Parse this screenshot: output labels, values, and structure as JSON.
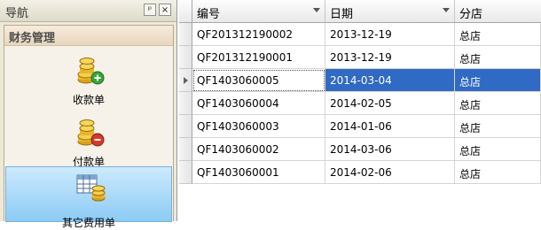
{
  "nav": {
    "title": "导航",
    "pin_glyph": "ᵖ",
    "close_glyph": "×",
    "group_title": "财务管理",
    "items": [
      {
        "label": "收款单",
        "icon": "coins-add-icon"
      },
      {
        "label": "付款单",
        "icon": "coins-remove-icon"
      },
      {
        "label": "其它费用单",
        "icon": "table-coins-icon"
      }
    ]
  },
  "grid": {
    "columns": [
      "编号",
      "日期",
      "分店"
    ],
    "rows": [
      {
        "code": "QF201312190002",
        "date": "2013-12-19",
        "store": "总店"
      },
      {
        "code": "QF201312190001",
        "date": "2013-12-19",
        "store": "总店"
      },
      {
        "code": "QF1403060005",
        "date": "2014-03-04",
        "store": "总店",
        "selected": true
      },
      {
        "code": "QF1403060004",
        "date": "2014-02-05",
        "store": "总店"
      },
      {
        "code": "QF1403060003",
        "date": "2014-01-06",
        "store": "总店"
      },
      {
        "code": "QF1403060002",
        "date": "2014-03-06",
        "store": "总店"
      },
      {
        "code": "QF1403060001",
        "date": "2014-02-06",
        "store": "总店"
      }
    ],
    "selection_color": "#316ac5"
  }
}
